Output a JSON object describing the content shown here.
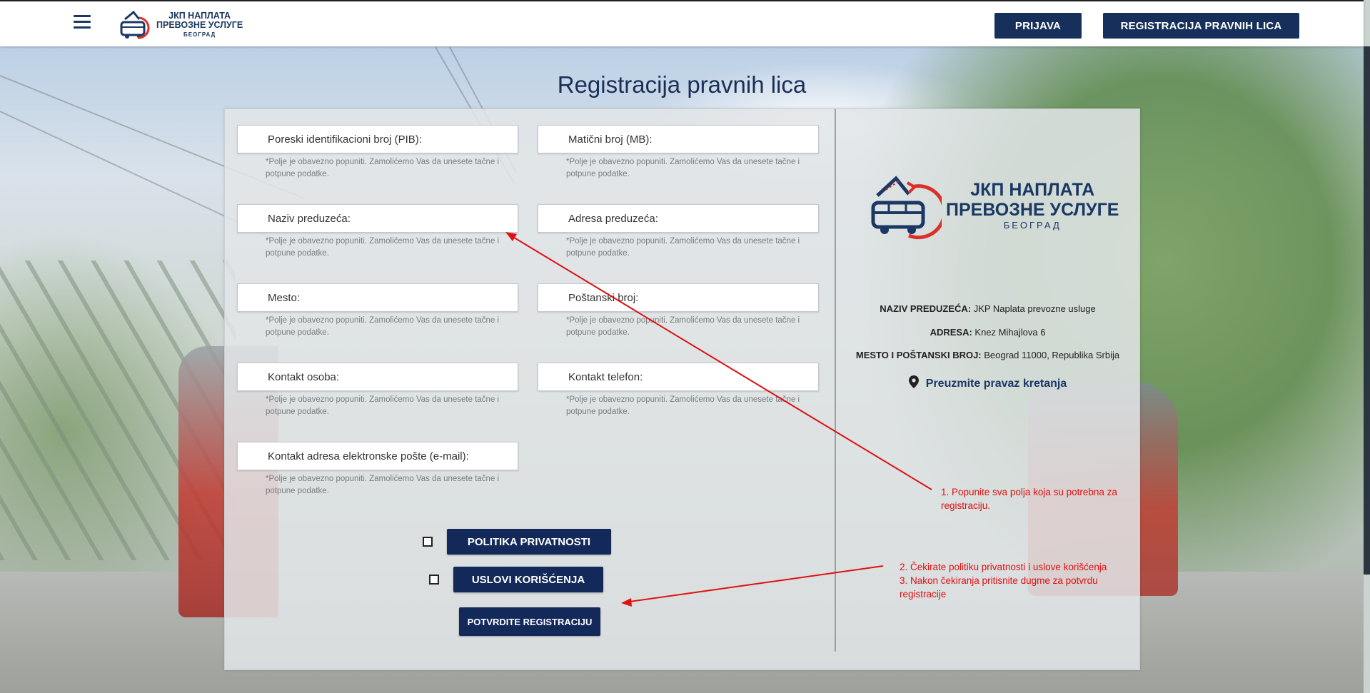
{
  "header": {
    "logo": {
      "line1": "ЈКП НАПЛАТА",
      "line2": "ПРЕВОЗНЕ УСЛУГЕ",
      "line3": "БЕОГРАД"
    },
    "login_label": "PRIJAVA",
    "register_label": "REGISTRACIJA PRAVNIH LICA"
  },
  "page": {
    "title": "Registracija pravnih lica"
  },
  "form": {
    "fields": [
      {
        "label": "Poreski identifikacioni broj (PIB):",
        "hint": "*Polje je obavezno popuniti. Zamolićemo Vas da unesete tačne i potpune podatke."
      },
      {
        "label": "Matični broj (MB):",
        "hint": "*Polje je obavezno popuniti. Zamolićemo Vas da unesete tačne i potpune podatke."
      },
      {
        "label": "Naziv preduzeća:",
        "hint": "*Polje je obavezno popuniti. Zamolićemo Vas da unesete tačne i potpune podatke."
      },
      {
        "label": "Adresa preduzeća:",
        "hint": "*Polje je obavezno popuniti. Zamolićemo Vas da unesete tačne i potpune podatke."
      },
      {
        "label": "Mesto:",
        "hint": "*Polje je obavezno popuniti. Zamolićemo Vas da unesete tačne i potpune podatke."
      },
      {
        "label": "Poštanski broj:",
        "hint": "*Polje je obavezno popuniti. Zamolićemo Vas da unesete tačne i potpune podatke."
      },
      {
        "label": "Kontakt osoba:",
        "hint": "*Polje je obavezno popuniti. Zamolićemo Vas da unesete tačne i potpune podatke."
      },
      {
        "label": "Kontakt telefon:",
        "hint": "*Polje je obavezno popuniti. Zamolićemo Vas da unesete tačne i potpune podatke."
      },
      {
        "label": "Kontakt adresa elektronske pošte (e-mail):",
        "hint": "*Polje je obavezno popuniti. Zamolićemo Vas da unesete tačne i potpune podatke."
      }
    ],
    "privacy_label": "POLITIKA PRIVATNOSTI",
    "terms_label": "USLOVI KORIŠĆENJA",
    "confirm_label": "POTVRDITE REGISTRACIJU"
  },
  "company": {
    "logo": {
      "line1": "ЈКП НАПЛАТА",
      "line2": "ПРЕВОЗНЕ УСЛУГЕ",
      "line3": "БЕОГРАД"
    },
    "name_key": "NAZIV PREDUZEĆA:",
    "name_value": "JKP Naplata prevozne usluge",
    "address_key": "ADRESA:",
    "address_value": "Knez Mihajlova 6",
    "city_key": "MESTO I POŠTANSKI BROJ:",
    "city_value": "Beograd 11000, Republika Srbija",
    "directions_label": "Preuzmite pravaz kretanja"
  },
  "annotations": {
    "note1_line1": "1. Popunite sva polja koja su potrebna za",
    "note1_line2": "registraciju.",
    "note2_line1": "2. Čekirate politiku privatnosti i uslove korišćenja",
    "note2_line2": "3. Nakon čekiranja pritisnite dugme za potvrdu",
    "note2_line3": "registracije"
  },
  "colors": {
    "brand": "#17305b",
    "annotation": "#e01010"
  }
}
